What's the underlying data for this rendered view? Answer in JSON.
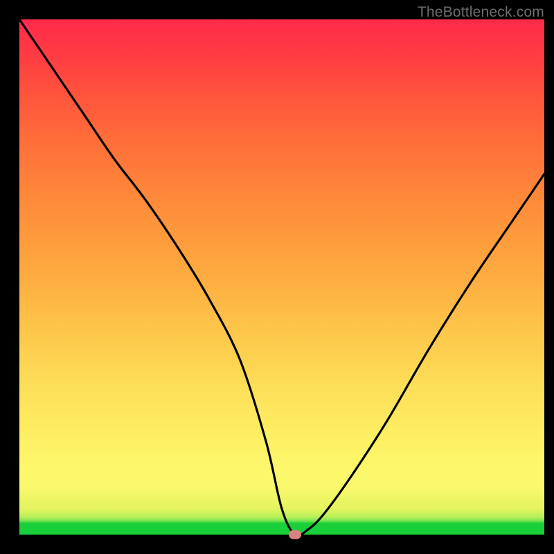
{
  "watermark": "TheBottleneck.com",
  "chart_data": {
    "type": "line",
    "title": "",
    "xlabel": "",
    "ylabel": "",
    "xlim": [
      0,
      100
    ],
    "ylim": [
      0,
      100
    ],
    "grid": false,
    "legend": false,
    "background_gradient": {
      "from": "#ff2a4a",
      "to": "#19cf3a",
      "direction": "top-to-bottom"
    },
    "series": [
      {
        "name": "bottleneck-curve",
        "color": "#000000",
        "x": [
          0,
          6,
          12,
          18,
          24,
          30,
          36,
          42,
          47,
          50,
          52.5,
          55,
          58,
          63,
          70,
          78,
          86,
          94,
          100
        ],
        "values": [
          100,
          91,
          82,
          73,
          65,
          56,
          46,
          34,
          18,
          5,
          0,
          1,
          4,
          11,
          22,
          36,
          49,
          61,
          70
        ]
      }
    ],
    "marker": {
      "x": 52.5,
      "y": 0,
      "shape": "pill",
      "color": "#d98080"
    }
  }
}
